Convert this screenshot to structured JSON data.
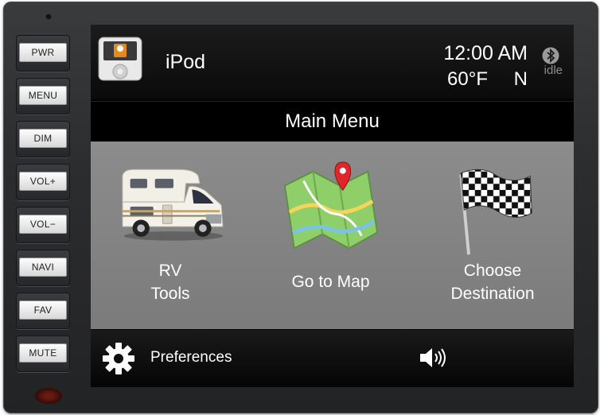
{
  "side_buttons": [
    "PWR",
    "MENU",
    "DIM",
    "VOL+",
    "VOL−",
    "NAVI",
    "FAV",
    "MUTE"
  ],
  "header": {
    "source": "iPod",
    "time": "12:00 AM",
    "temperature": "60°F",
    "heading": "N",
    "bluetooth_status": "idle"
  },
  "title": "Main Menu",
  "menu": {
    "rv_tools": [
      "RV",
      "Tools"
    ],
    "map": [
      "Go to Map"
    ],
    "destination": [
      "Choose",
      "Destination"
    ]
  },
  "footer": {
    "preferences": "Preferences"
  },
  "icons": {
    "source": "ipod-icon",
    "bluetooth": "bluetooth-icon",
    "rv": "rv-motorhome-icon",
    "map": "map-pin-icon",
    "destination": "checkered-flag-icon",
    "preferences": "gear-icon",
    "volume": "speaker-volume-icon"
  },
  "colors": {
    "menu_bg": "#848484",
    "map_pin": "#e0262b",
    "bezel": "#2c2d2f"
  }
}
